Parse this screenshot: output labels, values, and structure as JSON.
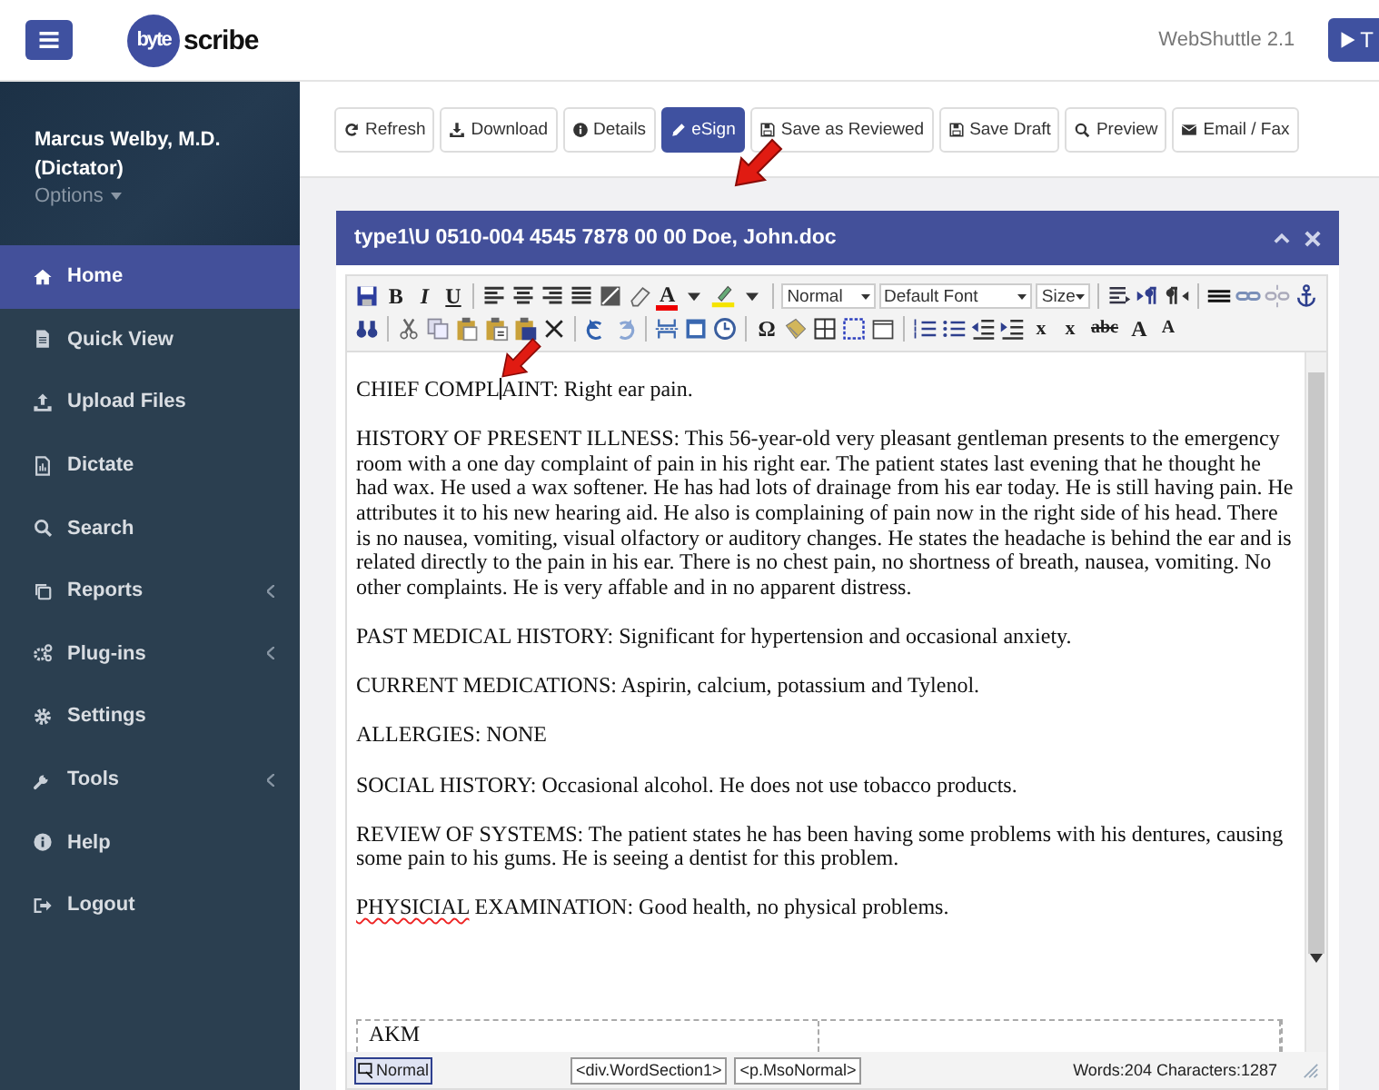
{
  "header": {
    "logo": [
      "byte",
      "scribe"
    ],
    "app_version": "WebShuttle 2.1",
    "cut_button": {
      "label": "T"
    }
  },
  "sidebar": {
    "user_name": "Marcus Welby, M.D.",
    "user_role": "(Dictator)",
    "options_label": "Options",
    "items": [
      {
        "label": "Home",
        "selected": true,
        "expandable": false
      },
      {
        "label": "Quick View",
        "selected": false,
        "expandable": false
      },
      {
        "label": "Upload Files",
        "selected": false,
        "expandable": false
      },
      {
        "label": "Dictate",
        "selected": false,
        "expandable": false
      },
      {
        "label": "Search",
        "selected": false,
        "expandable": false
      },
      {
        "label": "Reports",
        "selected": false,
        "expandable": true
      },
      {
        "label": "Plug-ins",
        "selected": false,
        "expandable": true
      },
      {
        "label": "Settings",
        "selected": false,
        "expandable": false
      },
      {
        "label": "Tools",
        "selected": false,
        "expandable": true
      },
      {
        "label": "Help",
        "selected": false,
        "expandable": false
      },
      {
        "label": "Logout",
        "selected": false,
        "expandable": false
      }
    ]
  },
  "actions": [
    {
      "label": "Refresh",
      "primary": false
    },
    {
      "label": "Download",
      "primary": false
    },
    {
      "label": "Details",
      "primary": false
    },
    {
      "label": "eSign",
      "primary": true
    },
    {
      "label": "Save as Reviewed",
      "primary": false
    },
    {
      "label": "Save Draft",
      "primary": false
    },
    {
      "label": "Preview",
      "primary": false
    },
    {
      "label": "Email / Fax",
      "primary": false
    }
  ],
  "document": {
    "title": "type1\\U 0510-004 4545 7878 00 00 Doe, John.doc",
    "toolbar": {
      "glyphs": [
        "B",
        "I",
        "U",
        "A",
        "Ω",
        "x",
        "x",
        "abc",
        "A",
        "A"
      ],
      "format_select": "Normal",
      "font_select": "Default Font",
      "size_select": "Size"
    },
    "paragraphs": [
      {
        "segments": [
          {
            "kind": "text",
            "text": "CHIEF COMPL"
          },
          {
            "kind": "cursor"
          },
          {
            "kind": "text",
            "text": "AINT:  Right ear pain."
          }
        ]
      },
      {
        "segments": [
          {
            "kind": "text",
            "text": "HISTORY OF PRESENT ILLNESS:  This 56-year-old very pleasant gentleman presents to the emergency room with a one day complaint of pain in his right ear. The patient states last evening that he thought he had wax.  He used a wax softener.  He has had lots of drainage from his ear today.  He is still having pain.  He attributes it to his new hearing aid.  He also is complaining of pain now in the right side of his head.  There is no nausea, vomiting, visual olfactory or auditory changes. He states the headache is behind the ear and is related directly to the pain in his ear. There is no chest pain, no shortness of breath, nausea, vomiting. No other complaints. He is very affable and in no apparent distress."
          }
        ]
      },
      {
        "segments": [
          {
            "kind": "text",
            "text": "PAST MEDICAL HISTORY:  Significant for hypertension and occasional anxiety."
          }
        ]
      },
      {
        "segments": [
          {
            "kind": "text",
            "text": "CURRENT MEDICATIONS:  Aspirin, calcium, potassium and Tylenol."
          }
        ]
      },
      {
        "segments": [
          {
            "kind": "text",
            "text": "ALLERGIES: NONE"
          }
        ]
      },
      {
        "segments": [
          {
            "kind": "text",
            "text": "SOCIAL HISTORY:  Occasional alcohol. He does not use tobacco products."
          }
        ]
      },
      {
        "segments": [
          {
            "kind": "text",
            "text": "REVIEW OF SYSTEMS:  The patient states he has been having some problems with his dentures, causing some pain to his gums. He is seeing a dentist for this problem."
          }
        ]
      },
      {
        "segments": [
          {
            "kind": "misspelled",
            "text": "PHYSICIAL"
          },
          {
            "kind": "text",
            "text": " EXAMINATION:  Good health, no physical problems."
          }
        ]
      }
    ],
    "table_cell": "AKM",
    "status": {
      "mode_button": "Normal",
      "path": [
        "<div.WordSection1>",
        "<p.MsoNormal>"
      ],
      "counts": "Words:204 Characters:1287"
    }
  }
}
